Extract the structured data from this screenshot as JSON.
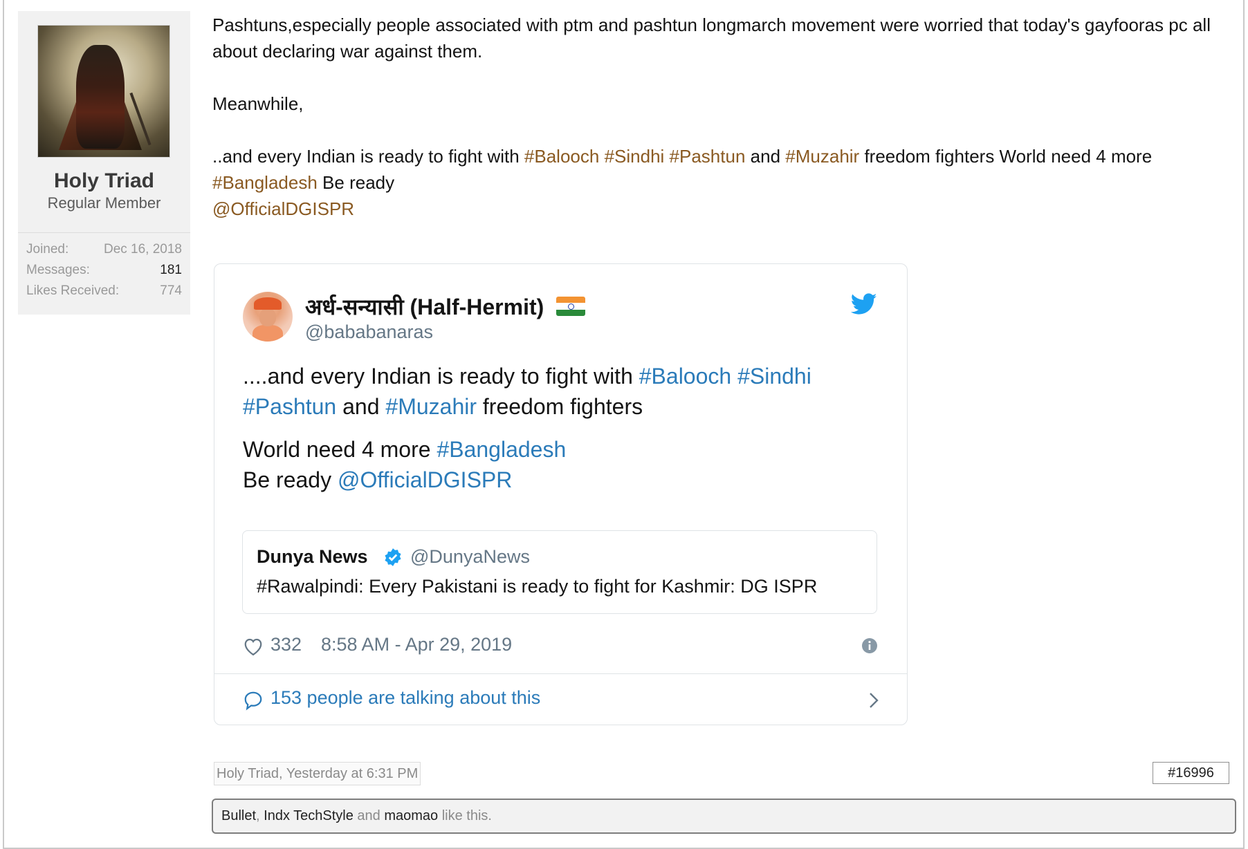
{
  "user": {
    "name": "Holy Triad",
    "title": "Regular Member",
    "stats": [
      {
        "label": "Joined:",
        "value": "Dec 16, 2018"
      },
      {
        "label": "Messages:",
        "value": "181"
      },
      {
        "label": "Likes Received:",
        "value": "774"
      }
    ]
  },
  "message": {
    "line1": "Pashtuns,especially people associated with ptm and pashtun longmarch movement were worried that today's gayfooras pc all about declaring war against them.",
    "line2": "Meanwhile,",
    "line3_pre": "..and every Indian is ready to fight with ",
    "tag_balooch": "#Balooch",
    "tag_sindhi": "#Sindhi",
    "tag_pashtun": "#Pashtun",
    "word_and": "and",
    "tag_muzahir": "#Muzahir",
    "line3_mid": "freedom fighters World need 4 more",
    "tag_bangladesh": "#Bangladesh",
    "be_ready": "Be ready",
    "mention": "@OfficialDGISPR"
  },
  "tweet": {
    "author_name": "अर्ध-सन्यासी (Half-Hermit)",
    "author_handle": "@bababanaras",
    "text_pre": "....and every Indian is ready to fight with ",
    "tag_balooch": "#Balooch",
    "tag_sindhi": "#Sindhi",
    "tag_pashtun": "#Pashtun",
    "word_and": "and",
    "tag_muzahir": "#Muzahir",
    "freedom_fighters": "freedom fighters",
    "world_need": "World need 4 more ",
    "tag_bangladesh": "#Bangladesh",
    "be_ready": "Be ready ",
    "mention": "@OfficialDGISPR",
    "quoted": {
      "name": "Dunya News",
      "handle": "@DunyaNews",
      "text": "#Rawalpindi: Every Pakistani is ready to fight for Kashmir: DG ISPR"
    },
    "likes": "332",
    "timestamp": "8:58 AM - Apr 29, 2019",
    "talking": "153 people are talking about this",
    "icons": [
      "twitter-bird-icon",
      "india-flag-icon",
      "verified-icon",
      "heart-icon",
      "info-icon",
      "speech-bubble-icon",
      "chevron-right-icon"
    ],
    "colors": {
      "link": "#2b7bb9",
      "bird": "#1da1f2",
      "verified": "#1da1f2",
      "muted": "#657786"
    }
  },
  "footer": {
    "author_date": "Holy Triad, Yesterday at 6:31 PM",
    "post_number": "#16996",
    "liker1": "Bullet",
    "sep": ", ",
    "liker2": "Indx TechStyle",
    "and": " and ",
    "liker3": "maomao",
    "suffix": " like this."
  },
  "colors": {
    "forum_tag": "#8a5a22",
    "panel_bg": "#f1f1f1"
  }
}
